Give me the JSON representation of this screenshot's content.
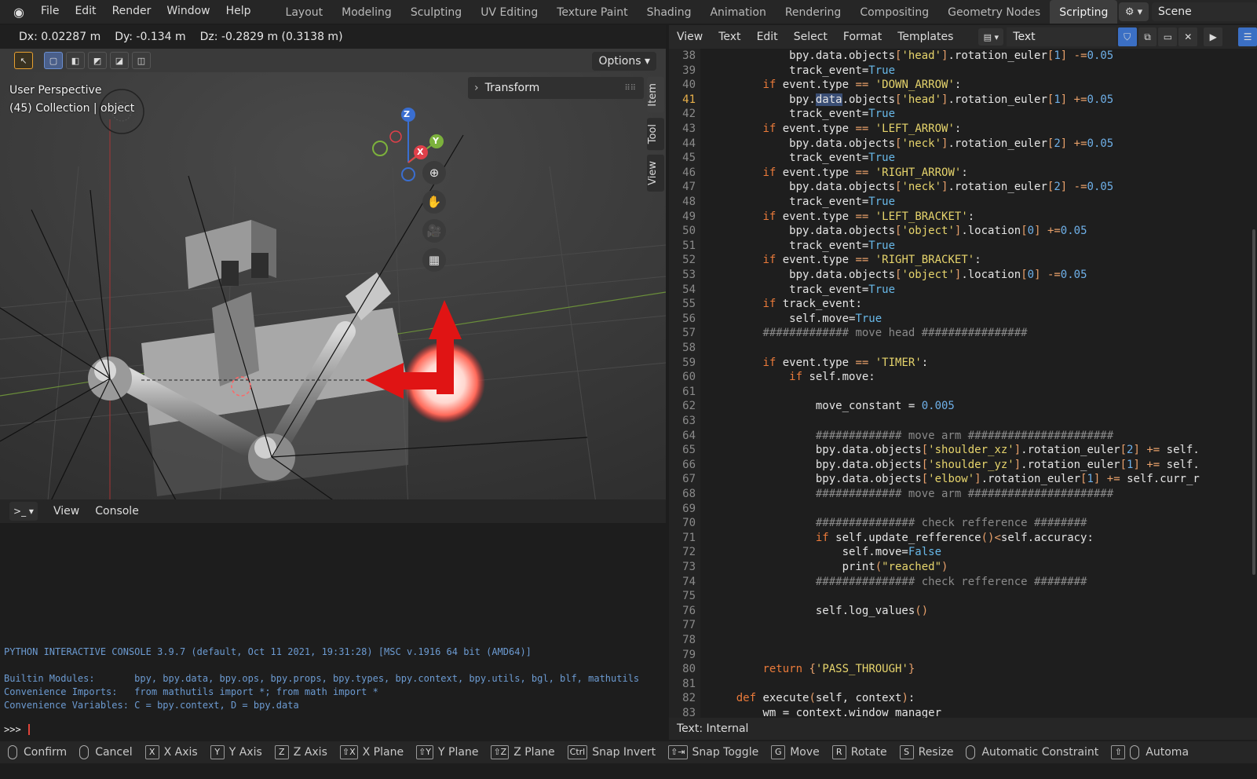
{
  "menu": [
    "File",
    "Edit",
    "Render",
    "Window",
    "Help"
  ],
  "workspaces": [
    "Layout",
    "Modeling",
    "Sculpting",
    "UV Editing",
    "Texture Paint",
    "Shading",
    "Animation",
    "Rendering",
    "Compositing",
    "Geometry Nodes",
    "Scripting"
  ],
  "active_workspace": "Scripting",
  "scene": {
    "name": "Scene"
  },
  "viewport": {
    "readout_dx": "Dx: 0.02287 m",
    "readout_dy": "Dy: -0.134 m",
    "readout_dz": "Dz: -0.2829 m (0.3138 m)",
    "options": "Options",
    "perspective": "User Perspective",
    "collection": "(45) Collection | object",
    "transform_panel": "Transform",
    "side_tabs": [
      "Item",
      "Tool",
      "View"
    ],
    "gizmo": {
      "z": "Z",
      "y": "Y",
      "x": "X"
    }
  },
  "console": {
    "menu": [
      "View",
      "Console"
    ],
    "banner": "PYTHON INTERACTIVE CONSOLE 3.9.7 (default, Oct 11 2021, 19:31:28) [MSC v.1916 64 bit (AMD64)]",
    "builtin": "Builtin Modules:       bpy, bpy.data, bpy.ops, bpy.props, bpy.types, bpy.context, bpy.utils, bgl, blf, mathutils",
    "imports": "Convenience Imports:   from mathutils import *; from math import *",
    "variables": "Convenience Variables: C = bpy.context, D = bpy.data",
    "prompt": ">>> "
  },
  "editor": {
    "menu": [
      "View",
      "Text",
      "Edit",
      "Select",
      "Format",
      "Templates"
    ],
    "text_name": "Text",
    "footer": "Text: Internal",
    "current_line": 41,
    "lines": [
      {
        "n": 38,
        "code": "            bpy.data.objects['head'].rotation_euler[1] -=0.05"
      },
      {
        "n": 39,
        "code": "            track_event=True"
      },
      {
        "n": 40,
        "code": "        if event.type == 'DOWN_ARROW':"
      },
      {
        "n": 41,
        "code": "            bpy.data.objects['head'].rotation_euler[1] +=0.05"
      },
      {
        "n": 42,
        "code": "            track_event=True"
      },
      {
        "n": 43,
        "code": "        if event.type == 'LEFT_ARROW':"
      },
      {
        "n": 44,
        "code": "            bpy.data.objects['neck'].rotation_euler[2] +=0.05"
      },
      {
        "n": 45,
        "code": "            track_event=True"
      },
      {
        "n": 46,
        "code": "        if event.type == 'RIGHT_ARROW':"
      },
      {
        "n": 47,
        "code": "            bpy.data.objects['neck'].rotation_euler[2] -=0.05"
      },
      {
        "n": 48,
        "code": "            track_event=True"
      },
      {
        "n": 49,
        "code": "        if event.type == 'LEFT_BRACKET':"
      },
      {
        "n": 50,
        "code": "            bpy.data.objects['object'].location[0] +=0.05"
      },
      {
        "n": 51,
        "code": "            track_event=True"
      },
      {
        "n": 52,
        "code": "        if event.type == 'RIGHT_BRACKET':"
      },
      {
        "n": 53,
        "code": "            bpy.data.objects['object'].location[0] -=0.05"
      },
      {
        "n": 54,
        "code": "            track_event=True"
      },
      {
        "n": 55,
        "code": "        if track_event:"
      },
      {
        "n": 56,
        "code": "            self.move=True"
      },
      {
        "n": 57,
        "code": "        ############# move head ################"
      },
      {
        "n": 58,
        "code": ""
      },
      {
        "n": 59,
        "code": "        if event.type == 'TIMER':"
      },
      {
        "n": 60,
        "code": "            if self.move:"
      },
      {
        "n": 61,
        "code": ""
      },
      {
        "n": 62,
        "code": "                move_constant = 0.005"
      },
      {
        "n": 63,
        "code": ""
      },
      {
        "n": 64,
        "code": "                ############# move arm ######################"
      },
      {
        "n": 65,
        "code": "                bpy.data.objects['shoulder_xz'].rotation_euler[2] += self."
      },
      {
        "n": 66,
        "code": "                bpy.data.objects['shoulder_yz'].rotation_euler[1] += self."
      },
      {
        "n": 67,
        "code": "                bpy.data.objects['elbow'].rotation_euler[1] += self.curr_r"
      },
      {
        "n": 68,
        "code": "                ############# move arm ######################"
      },
      {
        "n": 69,
        "code": ""
      },
      {
        "n": 70,
        "code": "                ############### check refference ########"
      },
      {
        "n": 71,
        "code": "                if self.update_refference()<self.accuracy:"
      },
      {
        "n": 72,
        "code": "                    self.move=False"
      },
      {
        "n": 73,
        "code": "                    print(\"reached\")"
      },
      {
        "n": 74,
        "code": "                ############### check refference ########"
      },
      {
        "n": 75,
        "code": ""
      },
      {
        "n": 76,
        "code": "                self.log_values()"
      },
      {
        "n": 77,
        "code": ""
      },
      {
        "n": 78,
        "code": ""
      },
      {
        "n": 79,
        "code": ""
      },
      {
        "n": 80,
        "code": "        return {'PASS_THROUGH'}"
      },
      {
        "n": 81,
        "code": ""
      },
      {
        "n": 82,
        "code": "    def execute(self, context):"
      },
      {
        "n": 83,
        "code": "        wm = context.window_manager"
      }
    ]
  },
  "statusbar": [
    {
      "key": "mouse",
      "label": "Confirm"
    },
    {
      "key": "mouse",
      "label": "Cancel"
    },
    {
      "key": "X",
      "label": "X Axis"
    },
    {
      "key": "Y",
      "label": "Y Axis"
    },
    {
      "key": "Z",
      "label": "Z Axis"
    },
    {
      "key": "⇧X",
      "label": "X Plane"
    },
    {
      "key": "⇧Y",
      "label": "Y Plane"
    },
    {
      "key": "⇧Z",
      "label": "Z Plane"
    },
    {
      "key": "Ctrl",
      "label": "Snap Invert"
    },
    {
      "key": "⇧⇥",
      "label": "Snap Toggle"
    },
    {
      "key": "G",
      "label": "Move"
    },
    {
      "key": "R",
      "label": "Rotate"
    },
    {
      "key": "S",
      "label": "Resize"
    },
    {
      "key": "mouse",
      "label": "Automatic Constraint"
    },
    {
      "key": "⇧mouse",
      "label": "Automa"
    }
  ]
}
